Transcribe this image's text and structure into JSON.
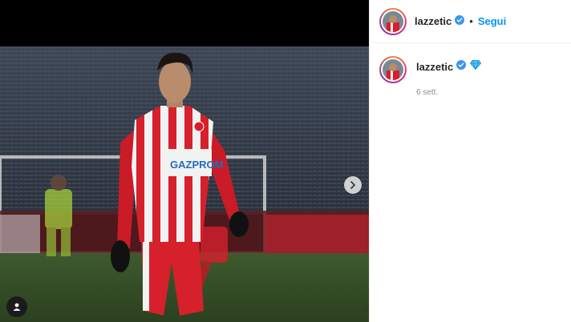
{
  "post": {
    "author": "lazzetic",
    "follow_label": "Segui",
    "separator": "•"
  },
  "caption": {
    "author": "lazzetic",
    "emoji": "gem-icon",
    "time": "6 sett."
  },
  "photo": {
    "sponsor_text": "GAZPROM"
  },
  "icons": {
    "next": "chevron-right-icon",
    "tags": "user-tag-icon",
    "verified": "verified-badge-icon"
  },
  "colors": {
    "link": "#0095f6",
    "verified": "#3897f0",
    "jersey_red": "#d6202b"
  }
}
